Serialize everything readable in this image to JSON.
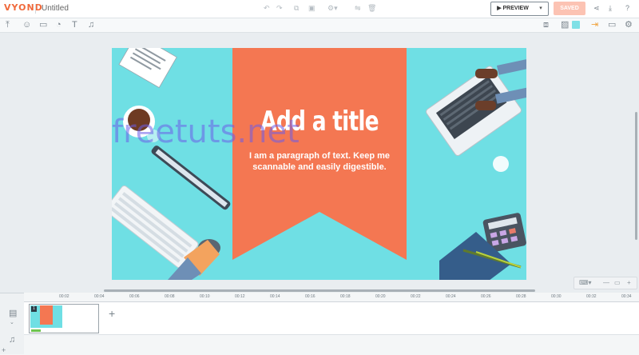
{
  "app": {
    "logo": "VYOND",
    "doc_title": "Untitled"
  },
  "topbar": {
    "undo_icon": "undo-icon",
    "redo_icon": "redo-icon",
    "preview_label": "▶ PREVIEW",
    "saved_label": "SAVED"
  },
  "slide": {
    "title": "Add a title",
    "paragraph": "I am a paragraph of text. Keep me scannable and easily digestible."
  },
  "watermark": "freetuts.net",
  "timeline": {
    "ticks": [
      "00:02",
      "00:04",
      "00:06",
      "00:08",
      "00:10",
      "00:12",
      "00:14",
      "00:16",
      "00:18",
      "00:20",
      "00:22",
      "00:24",
      "00:26",
      "00:28",
      "00:30",
      "00:32",
      "00:34"
    ],
    "scene_number": "1"
  },
  "colors": {
    "accent": "#f06a3c",
    "stage_bg": "#6fdfe4",
    "banner": "#f47752",
    "saved_bg": "#fcc3b3"
  }
}
